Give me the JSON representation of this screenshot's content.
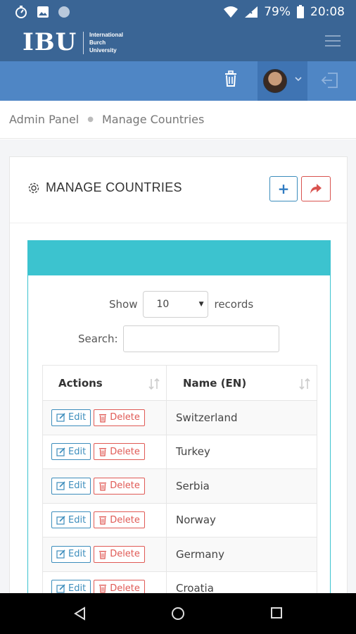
{
  "status_bar": {
    "battery_percent": "79%",
    "time": "20:08",
    "icons": [
      "timer-icon",
      "image-icon",
      "circle-icon",
      "wifi-icon",
      "cell-signal-icon",
      "battery-icon"
    ]
  },
  "brand": {
    "logo_text": "IBU",
    "logo_lines": [
      "International",
      "Burch",
      "University"
    ]
  },
  "toolbar": {
    "icons": [
      "trash-icon",
      "avatar",
      "chevron-down-icon",
      "logout-icon"
    ]
  },
  "breadcrumb": {
    "items": [
      "Admin Panel",
      "Manage Countries"
    ]
  },
  "card": {
    "title": "MANAGE COUNTRIES",
    "add_label": "+",
    "colors": {
      "accent": "#3cc3cf",
      "primary": "#3c8dbc",
      "danger": "#e05a55",
      "header": "#3a6595",
      "toolbar": "#4f86c5"
    }
  },
  "table_controls": {
    "show_label": "Show",
    "page_size": "10",
    "records_label": "records",
    "search_label": "Search:",
    "search_value": ""
  },
  "table": {
    "columns": [
      "Actions",
      "Name (EN)"
    ],
    "edit_label": "Edit",
    "delete_label": "Delete",
    "rows": [
      {
        "name": "Switzerland"
      },
      {
        "name": "Turkey"
      },
      {
        "name": "Serbia"
      },
      {
        "name": "Norway"
      },
      {
        "name": "Germany"
      },
      {
        "name": "Croatia"
      }
    ]
  }
}
